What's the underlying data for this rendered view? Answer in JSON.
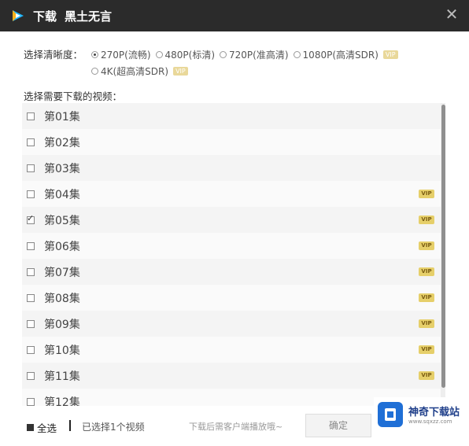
{
  "window": {
    "title_a": "下载",
    "title_b": "黑土无言"
  },
  "quality": {
    "label": "选择清晰度：",
    "options": [
      {
        "label": "270P(流畅)",
        "selected": true,
        "vip": false
      },
      {
        "label": "480P(标清)",
        "selected": false,
        "vip": false
      },
      {
        "label": "720P(准高清)",
        "selected": false,
        "vip": false
      },
      {
        "label": "1080P(高清SDR)",
        "selected": false,
        "vip": true
      },
      {
        "label": "4K(超高清SDR)",
        "selected": false,
        "vip": true
      }
    ]
  },
  "list": {
    "label": "选择需要下载的视频：",
    "vip_badge": "VIP",
    "episodes": [
      {
        "label": "第01集",
        "checked": false,
        "vip": false
      },
      {
        "label": "第02集",
        "checked": false,
        "vip": false
      },
      {
        "label": "第03集",
        "checked": false,
        "vip": false
      },
      {
        "label": "第04集",
        "checked": false,
        "vip": true
      },
      {
        "label": "第05集",
        "checked": true,
        "vip": true
      },
      {
        "label": "第06集",
        "checked": false,
        "vip": true
      },
      {
        "label": "第07集",
        "checked": false,
        "vip": true
      },
      {
        "label": "第08集",
        "checked": false,
        "vip": true
      },
      {
        "label": "第09集",
        "checked": false,
        "vip": true
      },
      {
        "label": "第10集",
        "checked": false,
        "vip": true
      },
      {
        "label": "第11集",
        "checked": false,
        "vip": true
      },
      {
        "label": "第12集",
        "checked": false,
        "vip": false
      }
    ]
  },
  "footer": {
    "select_all": "全选",
    "selected_count": "已选择1个视频",
    "hint": "下载后需客户端播放哦~",
    "confirm": "确定"
  },
  "watermark": {
    "name": "神奇下载站",
    "url": "www.sqxzz.com"
  }
}
